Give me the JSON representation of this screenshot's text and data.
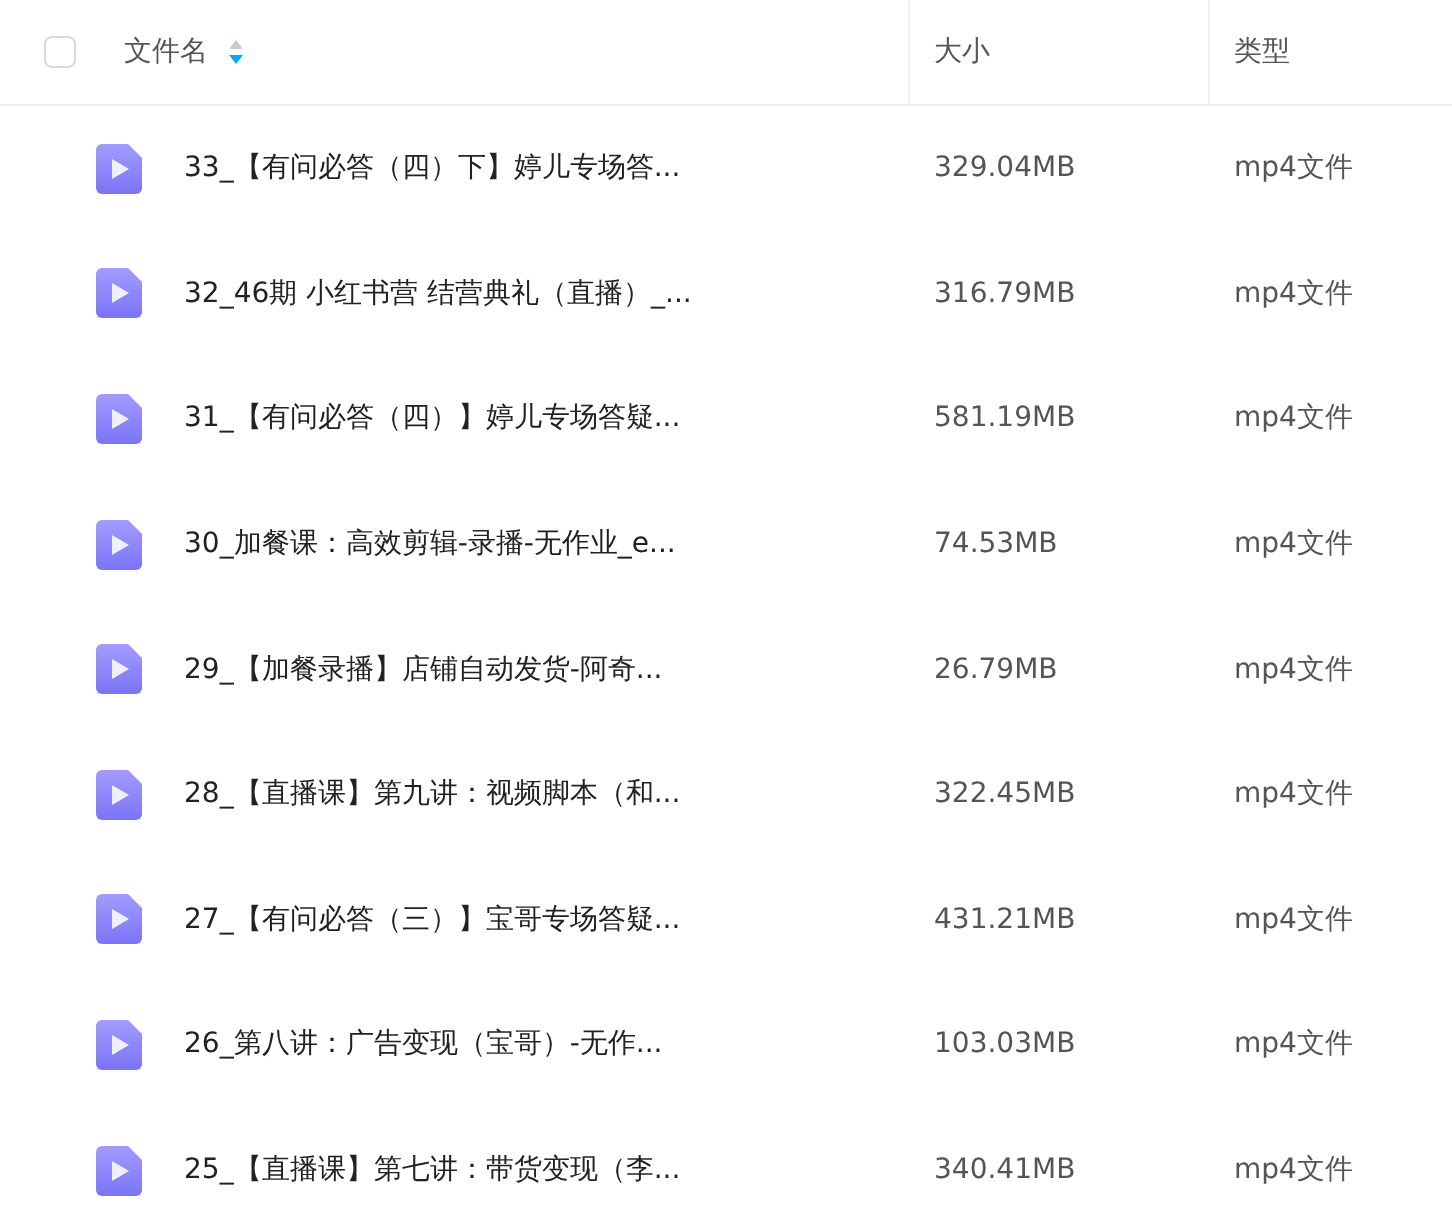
{
  "header": {
    "select_all": {
      "checked": false
    },
    "columns": [
      {
        "label": "文件名",
        "sorted_descending": true
      },
      {
        "label": "大小"
      },
      {
        "label": "类型"
      }
    ]
  },
  "rows": [
    {
      "name": "33_【有问必答（四）下】婷儿专场答...",
      "size": "329.04MB",
      "type": "mp4文件"
    },
    {
      "name": "32_46期 小红书营 结营典礼（直播）_...",
      "size": "316.79MB",
      "type": "mp4文件"
    },
    {
      "name": "31_【有问必答（四）】婷儿专场答疑...",
      "size": "581.19MB",
      "type": "mp4文件"
    },
    {
      "name": "30_加餐课：高效剪辑-录播-无作业_e...",
      "size": "74.53MB",
      "type": "mp4文件"
    },
    {
      "name": "29_【加餐录播】店铺自动发货-阿奇...",
      "size": "26.79MB",
      "type": "mp4文件"
    },
    {
      "name": "28_【直播课】第九讲：视频脚本（和...",
      "size": "322.45MB",
      "type": "mp4文件"
    },
    {
      "name": "27_【有问必答（三）】宝哥专场答疑...",
      "size": "431.21MB",
      "type": "mp4文件"
    },
    {
      "name": "26_第八讲：广告变现（宝哥）-无作...",
      "size": "103.03MB",
      "type": "mp4文件"
    },
    {
      "name": "25_【直播课】第七讲：带货变现（李...",
      "size": "340.41MB",
      "type": "mp4文件"
    }
  ]
}
